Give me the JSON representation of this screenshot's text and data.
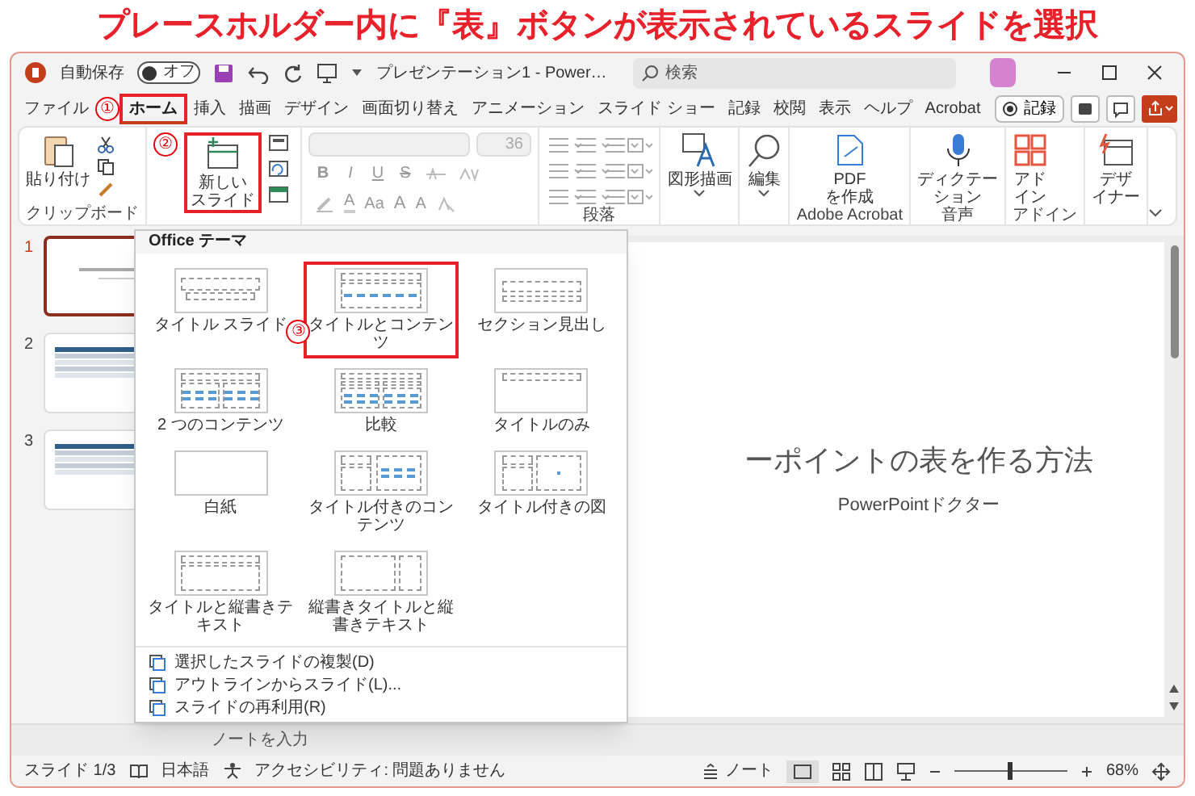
{
  "headline": "プレースホルダー内に『表』ボタンが表示されているスライドを選択",
  "title_bar": {
    "autosave_label": "自動保存",
    "autosave_state": "オフ",
    "autosave_on": false,
    "document_title": "プレゼンテーション1 - Power…",
    "search_placeholder": "検索"
  },
  "tabs": [
    {
      "label": "ファイル",
      "selected": false,
      "highlighted": false
    },
    {
      "label": "ホーム",
      "selected": true,
      "highlighted": true,
      "step": "①"
    },
    {
      "label": "挿入",
      "selected": false,
      "highlighted": false
    },
    {
      "label": "描画",
      "selected": false,
      "highlighted": false
    },
    {
      "label": "デザイン",
      "selected": false,
      "highlighted": false
    },
    {
      "label": "画面切り替え",
      "selected": false,
      "highlighted": false
    },
    {
      "label": "アニメーション",
      "selected": false,
      "highlighted": false
    },
    {
      "label": "スライド ショー",
      "selected": false,
      "highlighted": false
    },
    {
      "label": "記録",
      "selected": false,
      "highlighted": false
    },
    {
      "label": "校閲",
      "selected": false,
      "highlighted": false
    },
    {
      "label": "表示",
      "selected": false,
      "highlighted": false
    },
    {
      "label": "ヘルプ",
      "selected": false,
      "highlighted": false
    },
    {
      "label": "Acrobat",
      "selected": false,
      "highlighted": false
    }
  ],
  "record_button": "記録",
  "ribbon": {
    "paste": "貼り付け",
    "clipboard_label": "クリップボード",
    "new_slide": {
      "label": [
        "新しい",
        "スライド"
      ],
      "highlighted": true,
      "step": "②"
    },
    "font_size": "36",
    "font_buttons": [
      "B",
      "I",
      "U",
      "S"
    ],
    "font_buttons_row2": [
      {
        "text": "A",
        "kind": "color"
      },
      {
        "text": "Aa",
        "kind": "case"
      },
      {
        "text": "A",
        "kind": "grow"
      },
      {
        "text": "A",
        "kind": "shrink"
      }
    ],
    "paragraph_label": "段落",
    "drawing": "図形描画",
    "editing": "編集",
    "pdf": [
      "PDF",
      "を作成"
    ],
    "acrobat_label": "Adobe Acrobat",
    "dictation": [
      "ディクテー",
      "ション"
    ],
    "voice_label": "音声",
    "addins": [
      "アド",
      "イン"
    ],
    "addins_label": "アドイン",
    "designer": [
      "デザ",
      "イナー"
    ]
  },
  "layout_menu": {
    "header": "Office テーマ",
    "layouts": [
      {
        "label": "タイトル スライド",
        "kind": "title",
        "highlighted": false
      },
      {
        "label": "タイトルとコンテンツ",
        "kind": "title-content",
        "highlighted": true,
        "step": "③"
      },
      {
        "label": "セクション見出し",
        "kind": "section",
        "highlighted": false
      },
      {
        "label": "2 つのコンテンツ",
        "kind": "two-content",
        "highlighted": false
      },
      {
        "label": "比較",
        "kind": "comparison",
        "highlighted": false
      },
      {
        "label": "タイトルのみ",
        "kind": "title-only",
        "highlighted": false
      },
      {
        "label": "白紙",
        "kind": "blank",
        "highlighted": false
      },
      {
        "label": "タイトル付きのコンテンツ",
        "kind": "content-caption",
        "highlighted": false
      },
      {
        "label": "タイトル付きの図",
        "kind": "picture-caption",
        "highlighted": false
      },
      {
        "label": "タイトルと縦書きテキスト",
        "kind": "vertical-text",
        "highlighted": false
      },
      {
        "label": "縦書きタイトルと縦書きテキスト",
        "kind": "vertical-title",
        "highlighted": false
      }
    ],
    "commands": [
      "選択したスライドの複製(D)",
      "アウトラインからスライド(L)...",
      "スライドの再利用(R)"
    ]
  },
  "slides": [
    {
      "number": "1",
      "kind": "title",
      "selected": true
    },
    {
      "number": "2",
      "kind": "table",
      "selected": false
    },
    {
      "number": "3",
      "kind": "table",
      "selected": false
    }
  ],
  "slide": {
    "title": "ーポイントの表を作る方法",
    "subtitle": "PowerPointドクター"
  },
  "notes_placeholder": "ノートを入力",
  "status_bar": {
    "slide_count": "スライド 1/3",
    "language": "日本語",
    "accessibility": "アクセシビリティ: 問題ありません",
    "notes": "ノート",
    "zoom": "68%",
    "zoom_slider": {
      "level": 0.5
    }
  }
}
